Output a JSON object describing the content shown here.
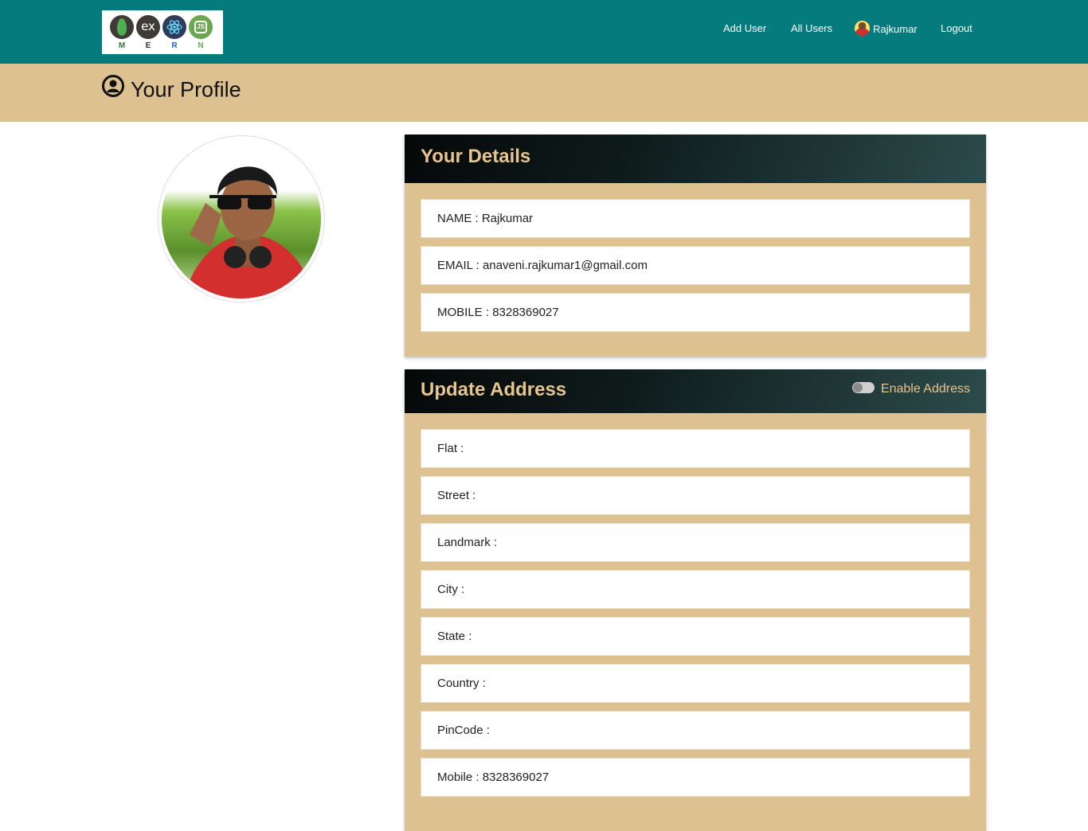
{
  "nav": {
    "logo_letters": [
      "M",
      "E",
      "R",
      "N"
    ],
    "logo_ex_text": "ex",
    "logo_js_text": "JS",
    "add_user": "Add User",
    "all_users": "All Users",
    "username": "Rajkumar",
    "logout": "Logout"
  },
  "page": {
    "title": "Your Profile"
  },
  "details": {
    "title": "Your Details",
    "fields": [
      {
        "label": "NAME : ",
        "value": "Rajkumar"
      },
      {
        "label": "EMAIL : ",
        "value": "anaveni.rajkumar1@gmail.com"
      },
      {
        "label": "MOBILE : ",
        "value": "8328369027"
      }
    ]
  },
  "address": {
    "title": "Update Address",
    "toggle_label": "Enable Address",
    "toggle_on": false,
    "fields": [
      {
        "label": "Flat : ",
        "value": ""
      },
      {
        "label": "Street : ",
        "value": ""
      },
      {
        "label": "Landmark : ",
        "value": ""
      },
      {
        "label": "City : ",
        "value": ""
      },
      {
        "label": "State : ",
        "value": ""
      },
      {
        "label": "Country : ",
        "value": ""
      },
      {
        "label": "PinCode : ",
        "value": ""
      },
      {
        "label": "Mobile : ",
        "value": "8328369027"
      }
    ]
  },
  "colors": {
    "nav_bg": "#057b7e",
    "band_bg": "#dec191",
    "card_title": "#e6c58e"
  }
}
